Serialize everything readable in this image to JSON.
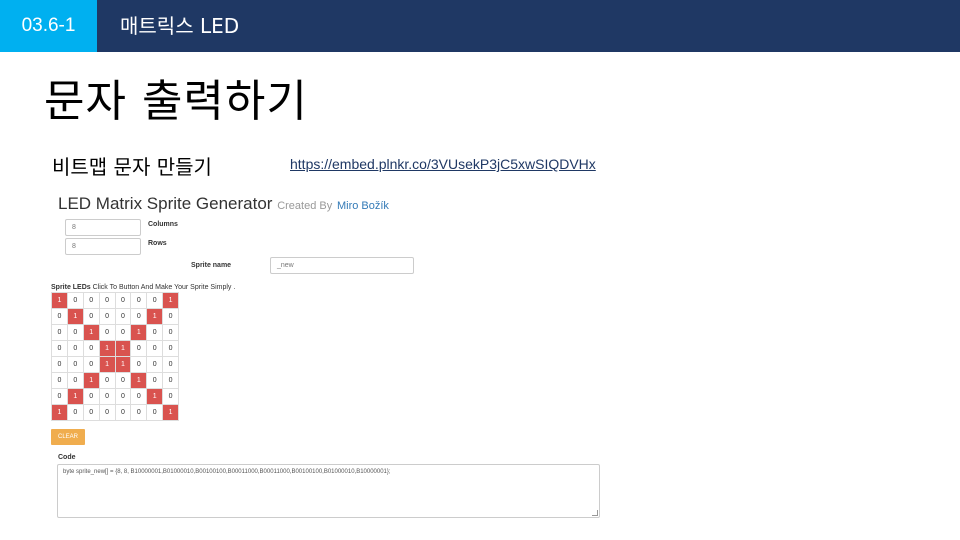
{
  "header": {
    "section_number": "03.6-1",
    "section_title": "매트릭스 LED"
  },
  "slide": {
    "title": "문자 출력하기",
    "subtitle": "비트맵 문자 만들기",
    "link": "https://embed.plnkr.co/3VUsekP3jC5xwSIQDVHx"
  },
  "app": {
    "title": "LED Matrix Sprite Generator",
    "created_by": "Created By",
    "author": "Miro Božík",
    "columns_value": "8",
    "columns_label": "Columns",
    "rows_value": "8",
    "rows_label": "Rows",
    "sprite_name_label": "Sprite name",
    "sprite_name_value": "_new",
    "leds_label": "Sprite LEDs",
    "leds_hint": "Click To Button And Make Your Sprite Simply .",
    "grid": [
      [
        1,
        0,
        0,
        0,
        0,
        0,
        0,
        1
      ],
      [
        0,
        1,
        0,
        0,
        0,
        0,
        1,
        0
      ],
      [
        0,
        0,
        1,
        0,
        0,
        1,
        0,
        0
      ],
      [
        0,
        0,
        0,
        1,
        1,
        0,
        0,
        0
      ],
      [
        0,
        0,
        0,
        1,
        1,
        0,
        0,
        0
      ],
      [
        0,
        0,
        1,
        0,
        0,
        1,
        0,
        0
      ],
      [
        0,
        1,
        0,
        0,
        0,
        0,
        1,
        0
      ],
      [
        1,
        0,
        0,
        0,
        0,
        0,
        0,
        1
      ]
    ],
    "clear_label": "CLEAR",
    "code_label": "Code",
    "code_value": "byte sprite_new[] = {8, 8, B10000001,B01000010,B00100100,B00011000,B00011000,B00100100,B01000010,B10000001};",
    "colors": {
      "led_on": "#d9534f",
      "clear_button": "#f0ad4e",
      "header_bar": "#1f3864",
      "badge": "#00b0f0"
    }
  }
}
